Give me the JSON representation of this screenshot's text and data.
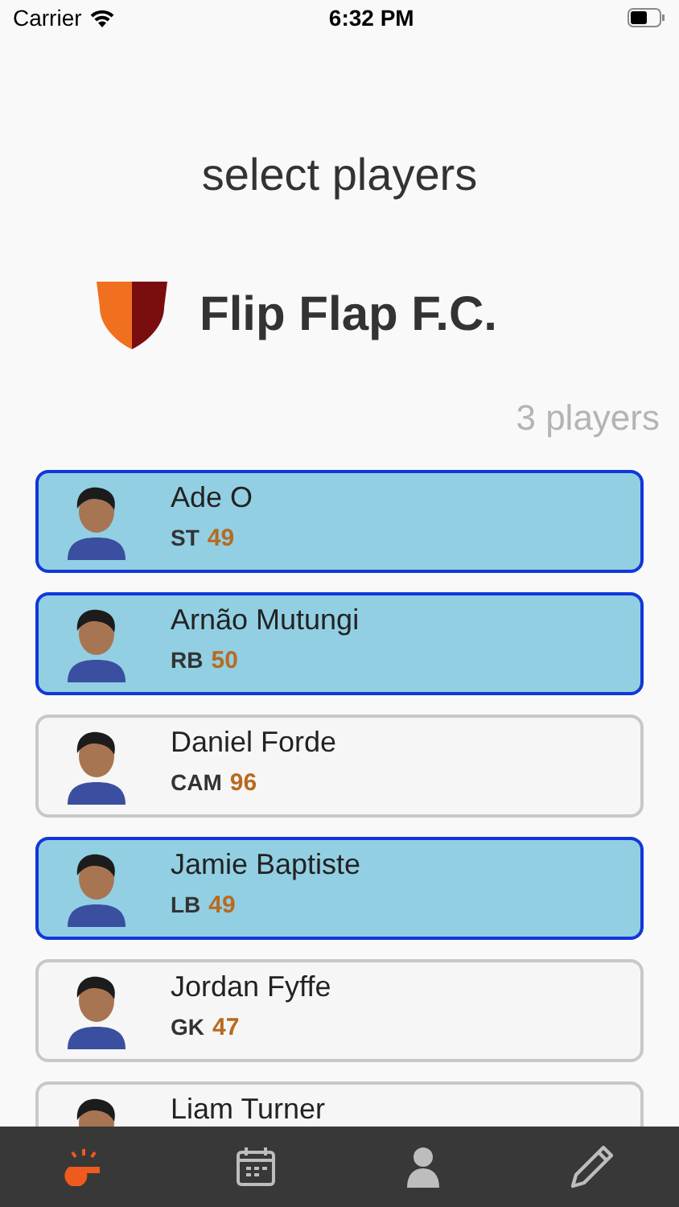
{
  "status_bar": {
    "carrier": "Carrier",
    "time": "6:32 PM"
  },
  "title": "select players",
  "team": {
    "name": "Flip Flap F.C."
  },
  "player_count": "3 players",
  "players": [
    {
      "name": "Ade O",
      "position": "ST",
      "rating": "49",
      "selected": true
    },
    {
      "name": "Arnão Mutungi",
      "position": "RB",
      "rating": "50",
      "selected": true
    },
    {
      "name": "Daniel Forde",
      "position": "CAM",
      "rating": "96",
      "selected": false
    },
    {
      "name": "Jamie Baptiste",
      "position": "LB",
      "rating": "49",
      "selected": true
    },
    {
      "name": "Jordan Fyffe",
      "position": "GK",
      "rating": "47",
      "selected": false
    },
    {
      "name": "Liam Turner",
      "selected": false
    }
  ],
  "tab_bar": [
    {
      "kind": "whistle",
      "selected": true
    },
    {
      "kind": "calendar",
      "selected": false
    },
    {
      "kind": "person",
      "selected": false
    },
    {
      "kind": "pencil",
      "selected": false
    }
  ]
}
